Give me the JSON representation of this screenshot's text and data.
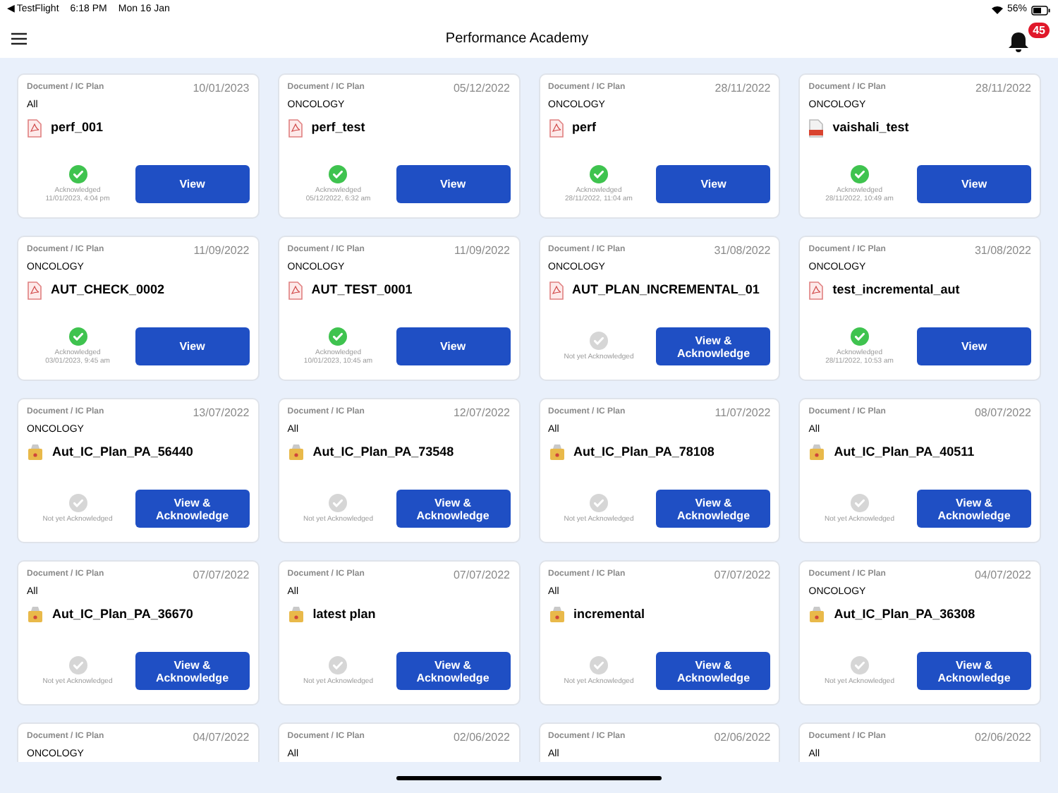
{
  "status_bar": {
    "back": "◀ TestFlight",
    "time": "6:18 PM",
    "date": "Mon 16 Jan",
    "battery": "56%"
  },
  "header": {
    "title": "Performance Academy",
    "notification_count": "45"
  },
  "cards": [
    {
      "type": "Document / IC Plan",
      "date": "10/01/2023",
      "category": "All",
      "kind": "pdf",
      "name": "perf_001",
      "acknowledged": true,
      "status": [
        "Acknowledged",
        "11/01/2023, 4:04 pm"
      ],
      "button": "View"
    },
    {
      "type": "Document / IC Plan",
      "date": "05/12/2022",
      "category": "ONCOLOGY",
      "kind": "pdf",
      "name": "perf_test",
      "acknowledged": true,
      "status": [
        "Acknowledged",
        "05/12/2022, 6:32 am"
      ],
      "button": "View"
    },
    {
      "type": "Document / IC Plan",
      "date": "28/11/2022",
      "category": "ONCOLOGY",
      "kind": "pdf",
      "name": "perf",
      "acknowledged": true,
      "status": [
        "Acknowledged",
        "28/11/2022, 11:04 am"
      ],
      "button": "View"
    },
    {
      "type": "Document / IC Plan",
      "date": "28/11/2022",
      "category": "ONCOLOGY",
      "kind": "ppt",
      "name": "vaishali_test",
      "acknowledged": true,
      "status": [
        "Acknowledged",
        "28/11/2022, 10:49 am"
      ],
      "button": "View"
    },
    {
      "type": "Document / IC Plan",
      "date": "11/09/2022",
      "category": "ONCOLOGY",
      "kind": "pdf",
      "name": "AUT_CHECK_0002",
      "acknowledged": true,
      "status": [
        "Acknowledged",
        "03/01/2023, 9:45 am"
      ],
      "button": "View"
    },
    {
      "type": "Document / IC Plan",
      "date": "11/09/2022",
      "category": "ONCOLOGY",
      "kind": "pdf",
      "name": "AUT_TEST_0001",
      "acknowledged": true,
      "status": [
        "Acknowledged",
        "10/01/2023, 10:45 am"
      ],
      "button": "View"
    },
    {
      "type": "Document / IC Plan",
      "date": "31/08/2022",
      "category": "ONCOLOGY",
      "kind": "pdf",
      "name": "AUT_PLAN_INCREMENTAL_01",
      "acknowledged": false,
      "status": [
        "Not yet Acknowledged"
      ],
      "button": "View & Acknowledge"
    },
    {
      "type": "Document / IC Plan",
      "date": "31/08/2022",
      "category": "ONCOLOGY",
      "kind": "pdf",
      "name": "test_incremental_aut",
      "acknowledged": true,
      "status": [
        "Acknowledged",
        "28/11/2022, 10:53 am"
      ],
      "button": "View"
    },
    {
      "type": "Document / IC Plan",
      "date": "13/07/2022",
      "category": "ONCOLOGY",
      "kind": "package",
      "name": "Aut_IC_Plan_PA_56440",
      "acknowledged": false,
      "status": [
        "Not yet Acknowledged"
      ],
      "button": "View & Acknowledge"
    },
    {
      "type": "Document / IC Plan",
      "date": "12/07/2022",
      "category": "All",
      "kind": "package",
      "name": "Aut_IC_Plan_PA_73548",
      "acknowledged": false,
      "status": [
        "Not yet Acknowledged"
      ],
      "button": "View & Acknowledge"
    },
    {
      "type": "Document / IC Plan",
      "date": "11/07/2022",
      "category": "All",
      "kind": "package",
      "name": "Aut_IC_Plan_PA_78108",
      "acknowledged": false,
      "status": [
        "Not yet Acknowledged"
      ],
      "button": "View & Acknowledge"
    },
    {
      "type": "Document / IC Plan",
      "date": "08/07/2022",
      "category": "All",
      "kind": "package",
      "name": "Aut_IC_Plan_PA_40511",
      "acknowledged": false,
      "status": [
        "Not yet Acknowledged"
      ],
      "button": "View & Acknowledge"
    },
    {
      "type": "Document / IC Plan",
      "date": "07/07/2022",
      "category": "All",
      "kind": "package",
      "name": "Aut_IC_Plan_PA_36670",
      "acknowledged": false,
      "status": [
        "Not yet Acknowledged"
      ],
      "button": "View & Acknowledge"
    },
    {
      "type": "Document / IC Plan",
      "date": "07/07/2022",
      "category": "All",
      "kind": "package",
      "name": "latest plan",
      "acknowledged": false,
      "status": [
        "Not yet Acknowledged"
      ],
      "button": "View & Acknowledge"
    },
    {
      "type": "Document / IC Plan",
      "date": "07/07/2022",
      "category": "All",
      "kind": "package",
      "name": "incremental",
      "acknowledged": false,
      "status": [
        "Not yet Acknowledged"
      ],
      "button": "View & Acknowledge"
    },
    {
      "type": "Document / IC Plan",
      "date": "04/07/2022",
      "category": "ONCOLOGY",
      "kind": "package",
      "name": "Aut_IC_Plan_PA_36308",
      "acknowledged": false,
      "status": [
        "Not yet Acknowledged"
      ],
      "button": "View & Acknowledge"
    },
    {
      "type": "Document / IC Plan",
      "date": "04/07/2022",
      "category": "ONCOLOGY"
    },
    {
      "type": "Document / IC Plan",
      "date": "02/06/2022",
      "category": "All"
    },
    {
      "type": "Document / IC Plan",
      "date": "02/06/2022",
      "category": "All"
    },
    {
      "type": "Document / IC Plan",
      "date": "02/06/2022",
      "category": "All"
    }
  ]
}
